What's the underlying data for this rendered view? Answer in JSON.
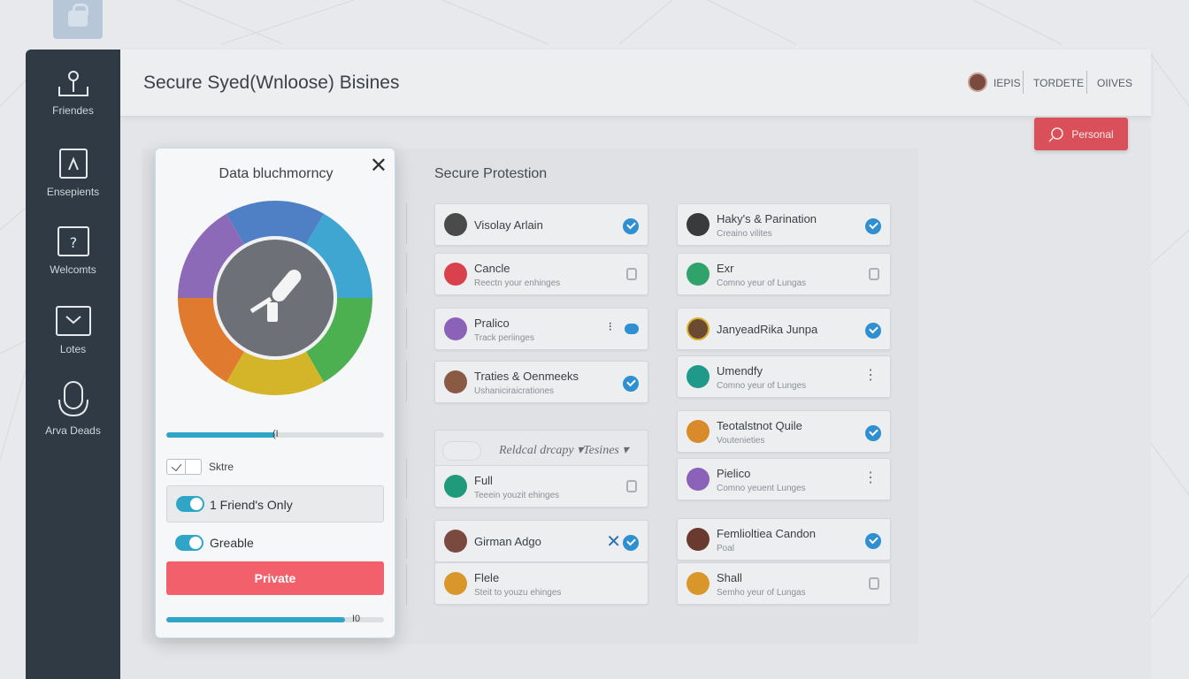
{
  "header": {
    "title": "Secure Syed(Wnloose) Bisines",
    "links": [
      "IEPIS",
      "TORDETE",
      "OIIVES"
    ]
  },
  "sidebar": {
    "items": [
      {
        "label": "Friendes",
        "icon": "pin-icon"
      },
      {
        "label": "Ensepients",
        "icon": "compass-icon"
      },
      {
        "label": "Welcomts",
        "icon": "help-icon"
      },
      {
        "label": "Lotes",
        "icon": "inbox-icon"
      },
      {
        "label": "Arva Deads",
        "icon": "microphone-icon"
      }
    ]
  },
  "personal_button": "Personal",
  "panel": {
    "title": "Secure Protestion",
    "combo_text": "Reldcal drcapy ▾Tesines ▾",
    "col1": [
      {
        "title": "Visolay Arlain",
        "subtitle": "",
        "status": "check"
      },
      {
        "title": "Cancle",
        "subtitle": "Reectn your enhinges",
        "status": "lock"
      },
      {
        "title": "Pralico",
        "subtitle": "Track periinges",
        "status": "dots"
      },
      {
        "title": "Traties & Oenmeeks",
        "subtitle": "Ushaniciraicrationes",
        "status": "check"
      },
      {
        "title": "Full",
        "subtitle": "Teeein youzit ehinges",
        "status": "lock"
      },
      {
        "title": "Girman Adgo",
        "subtitle": "",
        "status": "check"
      },
      {
        "title": "Flele",
        "subtitle": "Steit to youzu ehinges",
        "status": "none"
      }
    ],
    "col2": [
      {
        "title": "Haky's & Parination",
        "subtitle": "Creaino vilites",
        "status": "check"
      },
      {
        "title": "Exr",
        "subtitle": "Comno yeur of Lungas",
        "status": "lock"
      },
      {
        "title": "JanyeadRika Junpa",
        "subtitle": "",
        "status": "check"
      },
      {
        "title": "Umendfy",
        "subtitle": "Comno yeur of Lunges",
        "status": "dots"
      },
      {
        "title": "Teotalstnot Quile",
        "subtitle": "Voutenieties",
        "status": "check"
      },
      {
        "title": "Pielico",
        "subtitle": "Comno yeuent Lunges",
        "status": "dots"
      },
      {
        "title": "Femlioltiea Candon",
        "subtitle": "Poal",
        "status": "check"
      },
      {
        "title": "Shall",
        "subtitle": "Semho yeur of Lungas",
        "status": "lock"
      }
    ]
  },
  "modal": {
    "title": "Data bluchmorncy",
    "slider1_label": "(I",
    "slider1_value": 0.5,
    "checkbox_label": "Sktre",
    "toggle1_label": "1 Friend's Only",
    "toggle2_label": "Greable",
    "button_label": "Private",
    "slider2_label": "I0",
    "slider2_value": 0.82,
    "donut_colors": [
      "#4f7fc4",
      "#3fa5d1",
      "#4caf50",
      "#d4b52a",
      "#e07a2e",
      "#8c6ab8"
    ]
  },
  "colors": {
    "sidebar": "#2f3a44",
    "accent": "#2fa6c8",
    "danger": "#f2606b",
    "check": "#2f8fd0"
  }
}
